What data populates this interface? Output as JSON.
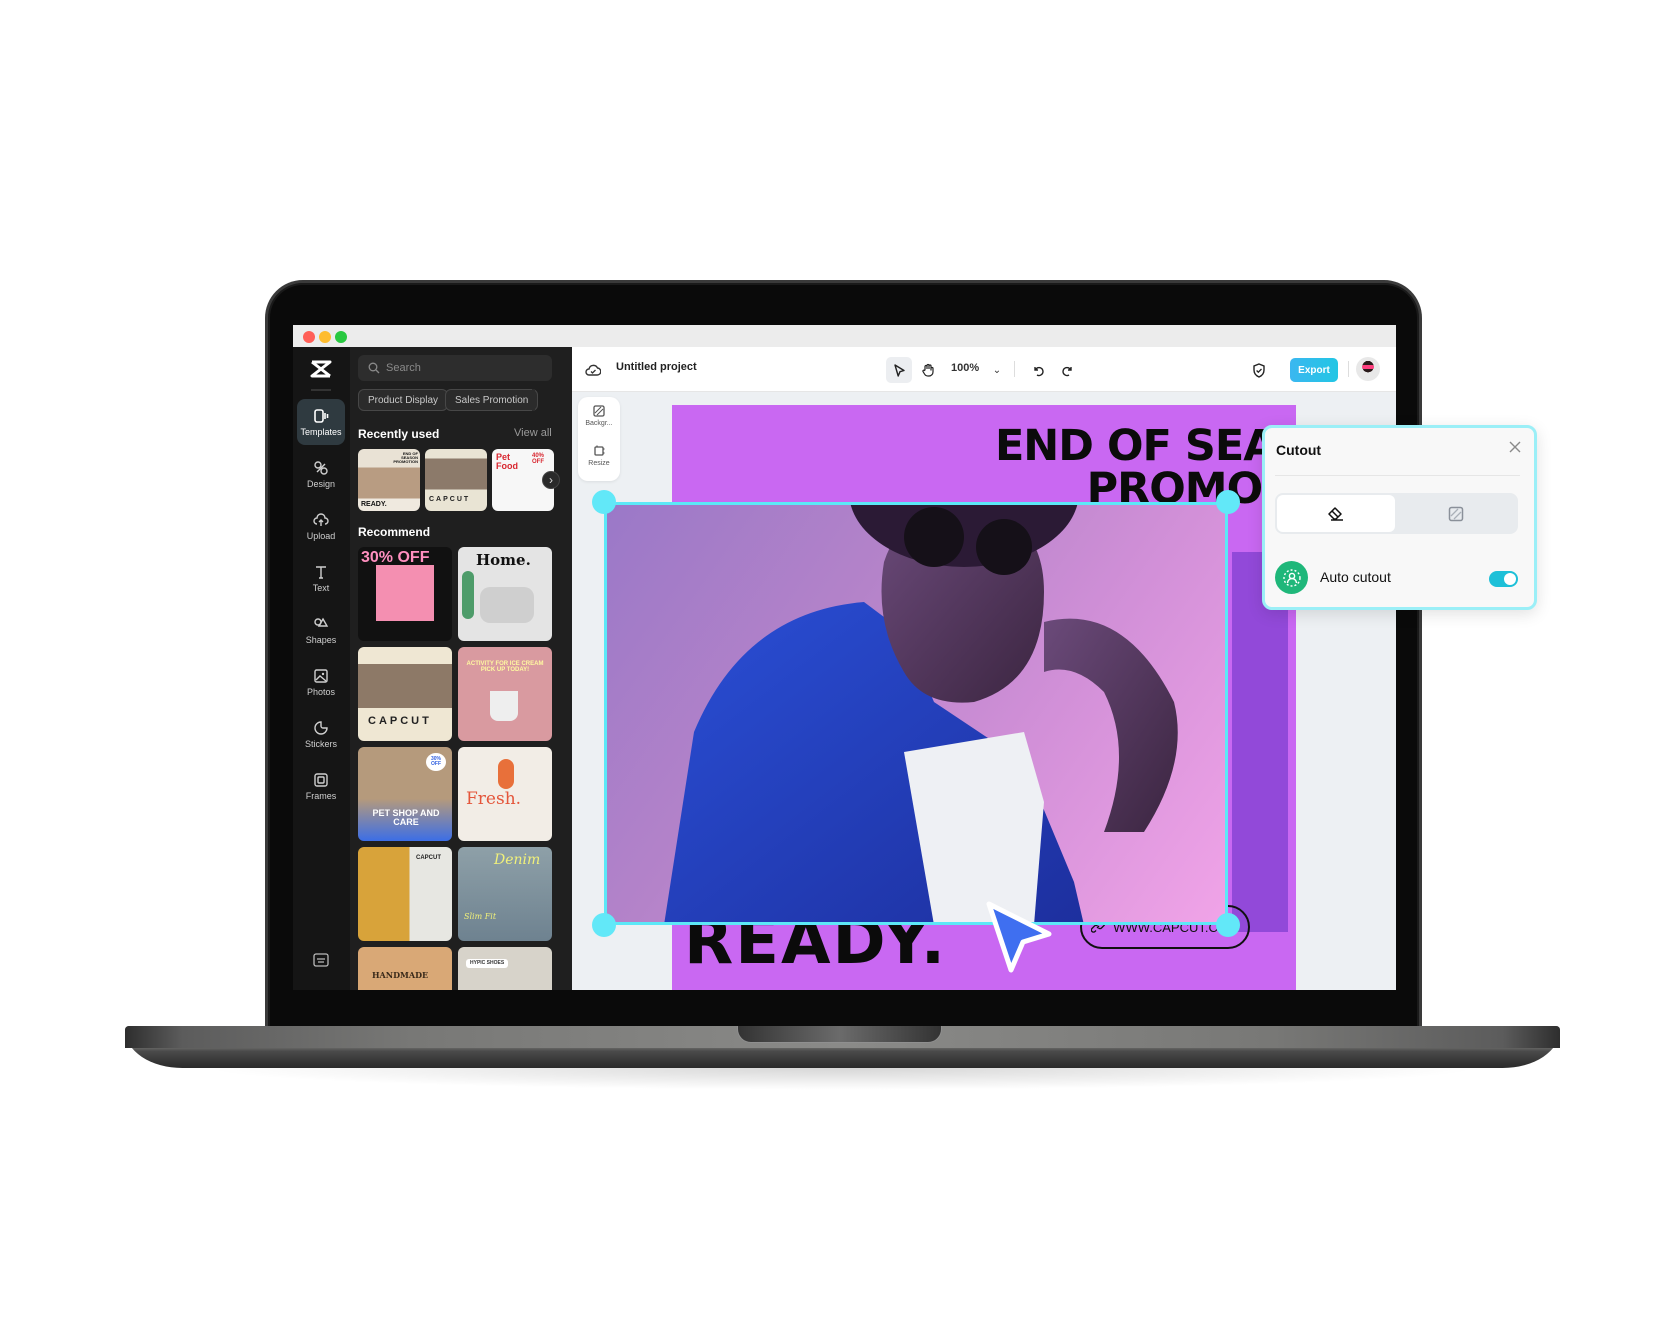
{
  "window": {
    "controls": {
      "close_color": "#ff5f57",
      "minimize_color": "#febc2e",
      "maximize_color": "#28c840"
    }
  },
  "rail": {
    "logo": "capcut-logo",
    "items": [
      {
        "label": "Templates",
        "icon": "templates-icon",
        "active": true
      },
      {
        "label": "Design",
        "icon": "design-icon"
      },
      {
        "label": "Upload",
        "icon": "upload-icon"
      },
      {
        "label": "Text",
        "icon": "text-icon"
      },
      {
        "label": "Shapes",
        "icon": "shapes-icon"
      },
      {
        "label": "Photos",
        "icon": "photos-icon"
      },
      {
        "label": "Stickers",
        "icon": "stickers-icon"
      },
      {
        "label": "Frames",
        "icon": "frames-icon"
      }
    ],
    "bottom_icon": "keyboard-icon"
  },
  "panel": {
    "search_placeholder": "Search",
    "chips": [
      "Product Display",
      "Sales Promotion"
    ],
    "recently_used": {
      "title": "Recently used",
      "view_all": "View all",
      "items": [
        {
          "title": "END OF SEASON PROMOTION",
          "caption": "READY."
        },
        {
          "title": "CAPCUT"
        },
        {
          "title": "Pet Food",
          "badge": "40% OFF"
        }
      ]
    },
    "recommend": {
      "title": "Recommend",
      "items": [
        {
          "title": "30% OFF"
        },
        {
          "title": "Home."
        },
        {
          "title": "CAPCUT"
        },
        {
          "title": "ACTIVITY FOR ICE CREAM PICK UP TODAY!"
        },
        {
          "title": "PET SHOP AND CARE",
          "badge": "30% OFF"
        },
        {
          "title": "Fresh."
        },
        {
          "title": "CAPCUT"
        },
        {
          "title": "Denim",
          "caption": "Slim Fit"
        },
        {
          "title": "HANDMADE"
        },
        {
          "title": "HYPIC SHOES"
        }
      ]
    }
  },
  "toolbar": {
    "project_title": "Untitled project",
    "zoom": "100%",
    "export_label": "Export",
    "accent": "#22c6e4"
  },
  "side_tools": [
    {
      "label": "Backgr...",
      "icon": "background-icon"
    },
    {
      "label": "Resize",
      "icon": "resize-icon"
    }
  ],
  "canvas": {
    "headline_line1": "END OF SEASON",
    "headline_line2": "PROMOTION",
    "footer_text": "READY.",
    "url": "WWW.CAPCUT.COM",
    "card_color": "#c968f2",
    "selection_color": "#5ce8f7"
  },
  "cutout_panel": {
    "title": "Cutout",
    "tabs": [
      {
        "icon": "eraser-icon",
        "active": true
      },
      {
        "icon": "background-remove-icon",
        "active": false
      }
    ],
    "auto_cutout_label": "Auto cutout",
    "auto_cutout_enabled": true
  }
}
